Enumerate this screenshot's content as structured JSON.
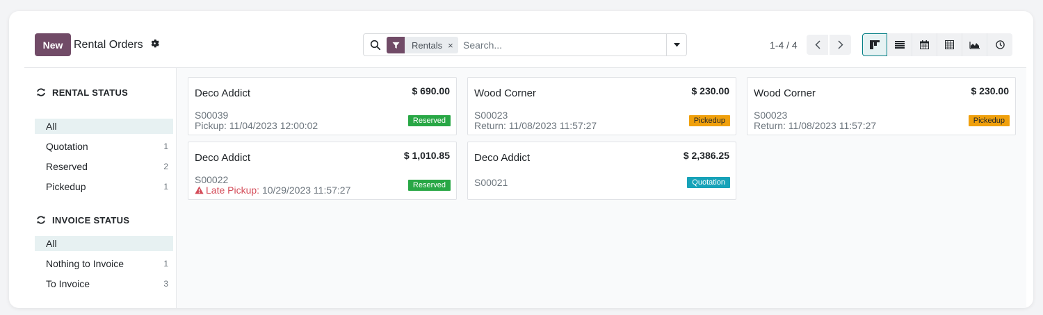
{
  "control_panel": {
    "new_label": "New",
    "title": "Rental Orders",
    "gear_icon": "gear-icon",
    "search": {
      "facet_icon": "filter-icon",
      "facet_label": "Rentals",
      "facet_remove": "×",
      "placeholder": "Search..."
    },
    "pager": {
      "value": "1-4 / 4"
    },
    "views": [
      "kanban",
      "list",
      "calendar",
      "pivot",
      "graph",
      "activity"
    ],
    "active_view": "kanban"
  },
  "sidebar": {
    "rental_status": {
      "header": "RENTAL STATUS",
      "items": [
        {
          "label": "All",
          "count": "",
          "active": true
        },
        {
          "label": "Quotation",
          "count": "1"
        },
        {
          "label": "Reserved",
          "count": "2"
        },
        {
          "label": "Pickedup",
          "count": "1"
        }
      ]
    },
    "invoice_status": {
      "header": "INVOICE STATUS",
      "items": [
        {
          "label": "All",
          "count": "",
          "active": true
        },
        {
          "label": "Nothing to Invoice",
          "count": "1"
        },
        {
          "label": "To Invoice",
          "count": "3"
        }
      ]
    }
  },
  "cards": [
    {
      "customer": "Deco Addict",
      "amount": "$ 690.00",
      "ref": "S00039",
      "line": "Pickup: 11/04/2023 12:00:02",
      "badge": "Reserved"
    },
    {
      "customer": "Wood Corner",
      "amount": "$ 230.00",
      "ref": "S00023",
      "line": "Return: 11/08/2023 11:57:27",
      "badge": "Pickedup"
    },
    {
      "customer": "Wood Corner",
      "amount": "$ 230.00",
      "ref": "S00023",
      "line": "Return: 11/08/2023 11:57:27",
      "badge": "Pickedup"
    },
    {
      "customer": "Deco Addict",
      "amount": "$ 1,010.85",
      "ref": "S00022",
      "late_label": "Late Pickup:",
      "line": "10/29/2023 11:57:27",
      "badge": "Reserved"
    },
    {
      "customer": "Deco Addict",
      "amount": "$ 2,386.25",
      "ref": "S00021",
      "badge": "Quotation"
    }
  ],
  "colors": {
    "brand": "#714b67",
    "accent": "#017e84",
    "reserved": "#28a745",
    "pickedup": "#f0a00c",
    "quotation": "#17a2b8",
    "late": "#d44c59"
  }
}
